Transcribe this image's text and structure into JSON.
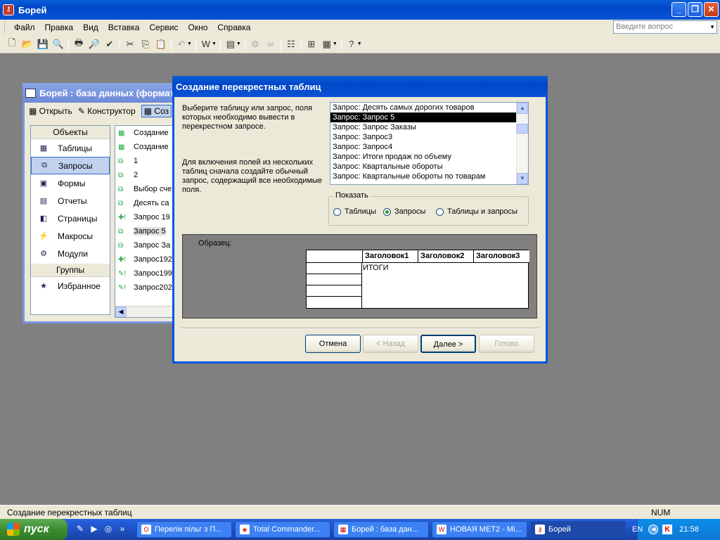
{
  "app": {
    "title": "Борей"
  },
  "menu": {
    "items": [
      "Файл",
      "Правка",
      "Вид",
      "Вставка",
      "Сервис",
      "Окно",
      "Справка"
    ],
    "ask_placeholder": "Введите вопрос"
  },
  "db_window": {
    "title": "Борей : база данных (формат",
    "toolbar": {
      "open": "Открыть",
      "design": "Конструктор",
      "create": "Соз"
    },
    "objects_header": "Объекты",
    "objects": [
      "Таблицы",
      "Запросы",
      "Формы",
      "Отчеты",
      "Страницы",
      "Макросы",
      "Модули"
    ],
    "selected_object": "Запросы",
    "groups_header": "Группы",
    "groups": [
      "Избранное"
    ],
    "list": [
      "Создание",
      "Создание",
      "1",
      "2",
      "Выбор сче",
      "Десять са",
      "Запрос 19",
      "Запрос 5",
      "Запрос За",
      "Запрос192",
      "Запрос199",
      "Запрос202"
    ]
  },
  "dialog": {
    "title": "Создание перекрестных таблиц",
    "text1": "Выберите таблицу или запрос, поля которых необходимо вывести в перекрестном запросе.",
    "text2": "Для включения полей из нескольких таблиц сначала создайте обычный запрос, содержащий все необходимые поля.",
    "queries": [
      "Запрос: Десять самых дорогих товаров",
      "Запрос: Запрос 5",
      "Запрос: Запрос Заказы",
      "Запрос: Запрос3",
      "Запрос: Запрос4",
      "Запрос: Итоги продаж по объему",
      "Запрос: Квартальные обороты",
      "Запрос: Квартальные обороты по товарам"
    ],
    "selected_query": "Запрос: Запрос 5",
    "show_group": {
      "label": "Показать",
      "options": [
        "Таблицы",
        "Запросы",
        "Таблицы и запросы"
      ],
      "selected": "Запросы"
    },
    "sample": {
      "label": "Образец:",
      "headers": [
        "Заголовок1",
        "Заголовок2",
        "Заголовок3"
      ],
      "total": "ИТОГИ"
    },
    "buttons": {
      "cancel": "Отмена",
      "back": "< Назад",
      "next": "Далее >",
      "finish": "Готово"
    }
  },
  "status": {
    "text": "Создание перекрестных таблиц",
    "num": "NUM"
  },
  "taskbar": {
    "start": "пуск",
    "tasks": [
      "Перелік пільг з П...",
      "Total Commander...",
      "Борей : база дан...",
      "НОВАЯ МЕТ2 - Mi...",
      "Борей"
    ],
    "active_task": "Борей",
    "lang": "EN",
    "clock": "21:58"
  }
}
